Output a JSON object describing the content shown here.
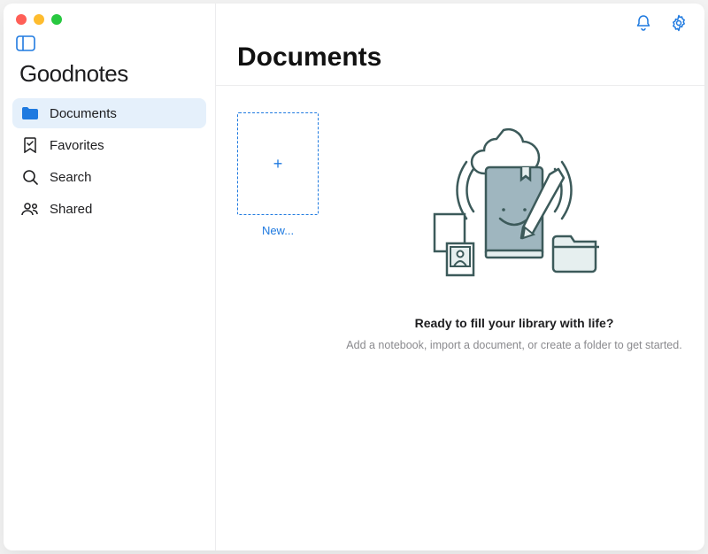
{
  "app": {
    "title": "Goodnotes"
  },
  "sidebar": {
    "items": [
      {
        "label": "Documents",
        "icon": "folder-icon",
        "active": true
      },
      {
        "label": "Favorites",
        "icon": "bookmark-icon",
        "active": false
      },
      {
        "label": "Search",
        "icon": "search-icon",
        "active": false
      },
      {
        "label": "Shared",
        "icon": "people-icon",
        "active": false
      }
    ]
  },
  "header": {
    "title": "Documents"
  },
  "new_tile": {
    "label": "New...",
    "plus": "+"
  },
  "empty": {
    "title": "Ready to fill your library with life?",
    "subtitle": "Add a notebook, import a document, or create a folder to get started."
  },
  "colors": {
    "accent": "#1f7ae0",
    "sidebar_active_bg": "#e5f0fb"
  }
}
